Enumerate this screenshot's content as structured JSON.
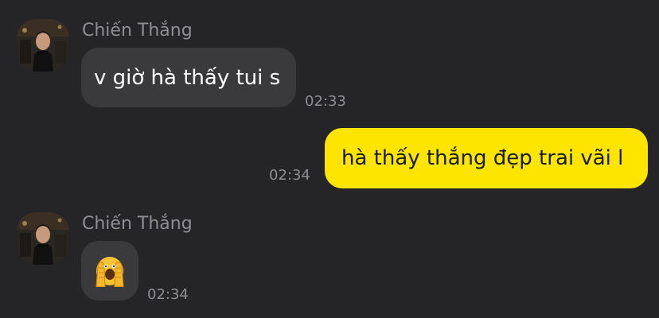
{
  "theme": {
    "background": "#252527",
    "incoming_bubble": "#3a3a3c",
    "outgoing_bubble": "#fee500",
    "meta_text": "#8e8e93"
  },
  "messages": [
    {
      "direction": "incoming",
      "sender": "Chiến Thắng",
      "avatar": "avatar-photo",
      "text": "v giờ hà thấy tui s",
      "time": "02:33"
    },
    {
      "direction": "outgoing",
      "text": "hà thấy thắng đẹp trai vãi l",
      "time": "02:34"
    },
    {
      "direction": "incoming",
      "sender": "Chiến Thắng",
      "avatar": "avatar-photo",
      "sticker": "hands-over-face-emoji",
      "time": "02:34"
    }
  ]
}
